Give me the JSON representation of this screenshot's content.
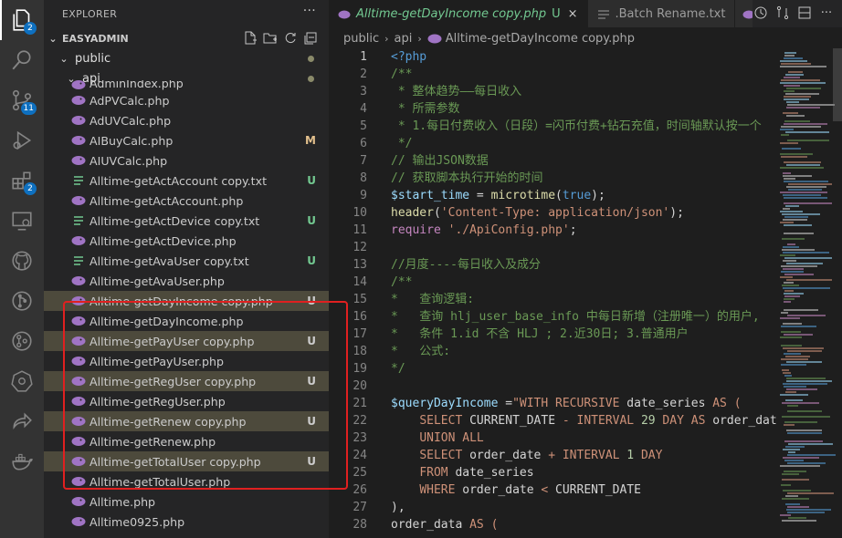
{
  "activity_bar": {
    "items": [
      {
        "name": "explorer",
        "badge": "2"
      },
      {
        "name": "search",
        "badge": ""
      },
      {
        "name": "source-control",
        "badge": "11"
      },
      {
        "name": "run-debug",
        "badge": ""
      },
      {
        "name": "extensions",
        "badge": "2"
      },
      {
        "name": "remote-explorer",
        "badge": ""
      },
      {
        "name": "github",
        "badge": ""
      },
      {
        "name": "git-graph",
        "badge": ""
      },
      {
        "name": "gitlens",
        "badge": ""
      },
      {
        "name": "kubernetes",
        "badge": ""
      },
      {
        "name": "share",
        "badge": ""
      },
      {
        "name": "docker",
        "badge": ""
      }
    ]
  },
  "explorer": {
    "title": "EXPLORER",
    "more": "···",
    "project": "EASYADMIN",
    "folders": [
      {
        "label": "public",
        "level": 1
      },
      {
        "label": "api",
        "level": 2
      }
    ],
    "files": [
      {
        "label": "AdminIndex.php",
        "color": "php",
        "status": "",
        "selected": false
      },
      {
        "label": "AdPVCalc.php",
        "color": "php",
        "status": "",
        "selected": false
      },
      {
        "label": "AdUVCalc.php",
        "color": "php",
        "status": "",
        "selected": false
      },
      {
        "label": "AIBuyCalc.php",
        "color": "mod",
        "status": "M",
        "selected": false
      },
      {
        "label": "AIUVCalc.php",
        "color": "php",
        "status": "",
        "selected": false
      },
      {
        "label": "Alltime-getActAccount copy.txt",
        "color": "green",
        "status": "U",
        "selected": false
      },
      {
        "label": "Alltime-getActAccount.php",
        "color": "php",
        "status": "",
        "selected": false
      },
      {
        "label": "Alltime-getActDevice copy.txt",
        "color": "green",
        "status": "U",
        "selected": false
      },
      {
        "label": "Alltime-getActDevice.php",
        "color": "php",
        "status": "",
        "selected": false
      },
      {
        "label": "Alltime-getAvaUser copy.txt",
        "color": "green",
        "status": "U",
        "selected": false
      },
      {
        "label": "Alltime-getAvaUser.php",
        "color": "php",
        "status": "",
        "selected": false
      },
      {
        "label": "Alltime-getDayIncome copy.php",
        "color": "php",
        "status": "U",
        "selected": true
      },
      {
        "label": "Alltime-getDayIncome.php",
        "color": "php",
        "status": "",
        "selected": false
      },
      {
        "label": "Alltime-getPayUser copy.php",
        "color": "php",
        "status": "U",
        "selected": true
      },
      {
        "label": "Alltime-getPayUser.php",
        "color": "php",
        "status": "",
        "selected": false
      },
      {
        "label": "Alltime-getRegUser copy.php",
        "color": "php",
        "status": "U",
        "selected": true
      },
      {
        "label": "Alltime-getRegUser.php",
        "color": "php",
        "status": "",
        "selected": false
      },
      {
        "label": "Alltime-getRenew copy.php",
        "color": "php",
        "status": "U",
        "selected": true
      },
      {
        "label": "Alltime-getRenew.php",
        "color": "php",
        "status": "",
        "selected": false
      },
      {
        "label": "Alltime-getTotalUser copy.php",
        "color": "php",
        "status": "U",
        "selected": true
      },
      {
        "label": "Alltime-getTotalUser.php",
        "color": "php",
        "status": "",
        "selected": false
      },
      {
        "label": "Alltime.php",
        "color": "php",
        "status": "",
        "selected": false
      },
      {
        "label": "Alltime0925.php",
        "color": "php",
        "status": "",
        "selected": false
      }
    ]
  },
  "tabs": [
    {
      "label": "Alltime-getDayIncome copy.php",
      "status": "U",
      "close": "×",
      "active": true,
      "icon": "php-icon"
    },
    {
      "label": ".Batch Rename.txt",
      "status": "",
      "close": "",
      "active": false,
      "icon": "text-icon"
    }
  ],
  "breadcrumb": [
    "public",
    "api",
    "Alltime-getDayIncome copy.php"
  ],
  "code_lines": [
    {
      "n": "1",
      "tokens": [
        [
          "tag",
          "<?php"
        ]
      ]
    },
    {
      "n": "2",
      "tokens": [
        [
          "cmt",
          "/**"
        ]
      ]
    },
    {
      "n": "3",
      "tokens": [
        [
          "cmt",
          " * 整体趋势——每日收入"
        ]
      ]
    },
    {
      "n": "4",
      "tokens": [
        [
          "cmt",
          " * 所需参数"
        ]
      ]
    },
    {
      "n": "5",
      "tokens": [
        [
          "cmt",
          " * 1.每日付费收入（日段）=闪币付费+钻石充值，时间轴默认按一个"
        ]
      ]
    },
    {
      "n": "6",
      "tokens": [
        [
          "cmt",
          " */"
        ]
      ]
    },
    {
      "n": "7",
      "tokens": [
        [
          "cmt",
          "// 输出JSON数据"
        ]
      ]
    },
    {
      "n": "8",
      "tokens": [
        [
          "cmt",
          "// 获取脚本执行开始的时间"
        ]
      ]
    },
    {
      "n": "9",
      "tokens": [
        [
          "v",
          "$start_time"
        ],
        [
          "txt",
          " = "
        ],
        [
          "f",
          "microtime"
        ],
        [
          "txt",
          "("
        ],
        [
          "kw",
          "true"
        ],
        [
          "txt",
          ");"
        ]
      ]
    },
    {
      "n": "10",
      "tokens": [
        [
          "f",
          "header"
        ],
        [
          "txt",
          "("
        ],
        [
          "s",
          "'Content-Type: application/json'"
        ],
        [
          "txt",
          ");"
        ]
      ]
    },
    {
      "n": "11",
      "tokens": [
        [
          "k",
          "require"
        ],
        [
          "txt",
          " "
        ],
        [
          "s",
          "'./ApiConfig.php'"
        ],
        [
          "txt",
          ";"
        ]
      ]
    },
    {
      "n": "12",
      "tokens": []
    },
    {
      "n": "13",
      "tokens": [
        [
          "cmt",
          "//月度----每日收入及成分"
        ]
      ]
    },
    {
      "n": "14",
      "tokens": [
        [
          "cmt",
          "/**"
        ]
      ]
    },
    {
      "n": "15",
      "tokens": [
        [
          "cmt",
          "*   查询逻辑:"
        ]
      ]
    },
    {
      "n": "16",
      "tokens": [
        [
          "cmt",
          "*   查询 hlj_user_base_info 中每日新增（注册唯一）的用户,"
        ]
      ]
    },
    {
      "n": "17",
      "tokens": [
        [
          "cmt",
          "*   条件 1.id 不含 HLJ ; 2.近30日; 3.普通用户"
        ]
      ]
    },
    {
      "n": "18",
      "tokens": [
        [
          "cmt",
          "*   公式:"
        ]
      ]
    },
    {
      "n": "19",
      "tokens": [
        [
          "cmt",
          "*/"
        ]
      ]
    },
    {
      "n": "20",
      "tokens": []
    },
    {
      "n": "21",
      "tokens": [
        [
          "v",
          "$queryDayIncome"
        ],
        [
          "txt",
          " ="
        ],
        [
          "s",
          "\"WITH RECURSIVE "
        ],
        [
          "txt",
          "date_series "
        ],
        [
          "s",
          "AS ("
        ]
      ]
    },
    {
      "n": "22",
      "tokens": [
        [
          "txt",
          "    "
        ],
        [
          "s",
          "SELECT "
        ],
        [
          "txt",
          "CURRENT_DATE "
        ],
        [
          "s",
          "- INTERVAL "
        ],
        [
          "n",
          "29"
        ],
        [
          "s",
          " DAY AS "
        ],
        [
          "txt",
          "order_date"
        ]
      ]
    },
    {
      "n": "23",
      "tokens": [
        [
          "txt",
          "    "
        ],
        [
          "s",
          "UNION ALL"
        ]
      ]
    },
    {
      "n": "24",
      "tokens": [
        [
          "txt",
          "    "
        ],
        [
          "s",
          "SELECT "
        ],
        [
          "txt",
          "order_date "
        ],
        [
          "s",
          "+ INTERVAL "
        ],
        [
          "n",
          "1"
        ],
        [
          "s",
          " DAY"
        ]
      ]
    },
    {
      "n": "25",
      "tokens": [
        [
          "txt",
          "    "
        ],
        [
          "s",
          "FROM "
        ],
        [
          "txt",
          "date_series"
        ]
      ]
    },
    {
      "n": "26",
      "tokens": [
        [
          "txt",
          "    "
        ],
        [
          "s",
          "WHERE "
        ],
        [
          "txt",
          "order_date "
        ],
        [
          "s",
          "< "
        ],
        [
          "txt",
          "CURRENT_DATE"
        ]
      ]
    },
    {
      "n": "27",
      "tokens": [
        [
          "txt",
          "),"
        ]
      ]
    },
    {
      "n": "28",
      "tokens": [
        [
          "txt",
          "order_data "
        ],
        [
          "s",
          "AS ("
        ]
      ]
    }
  ],
  "colors": {
    "accent": "#0e70c0",
    "untracked": "#73c991",
    "modified": "#e2c08d",
    "highlight_box": "#e02020",
    "php_icon": "#a074c4"
  }
}
